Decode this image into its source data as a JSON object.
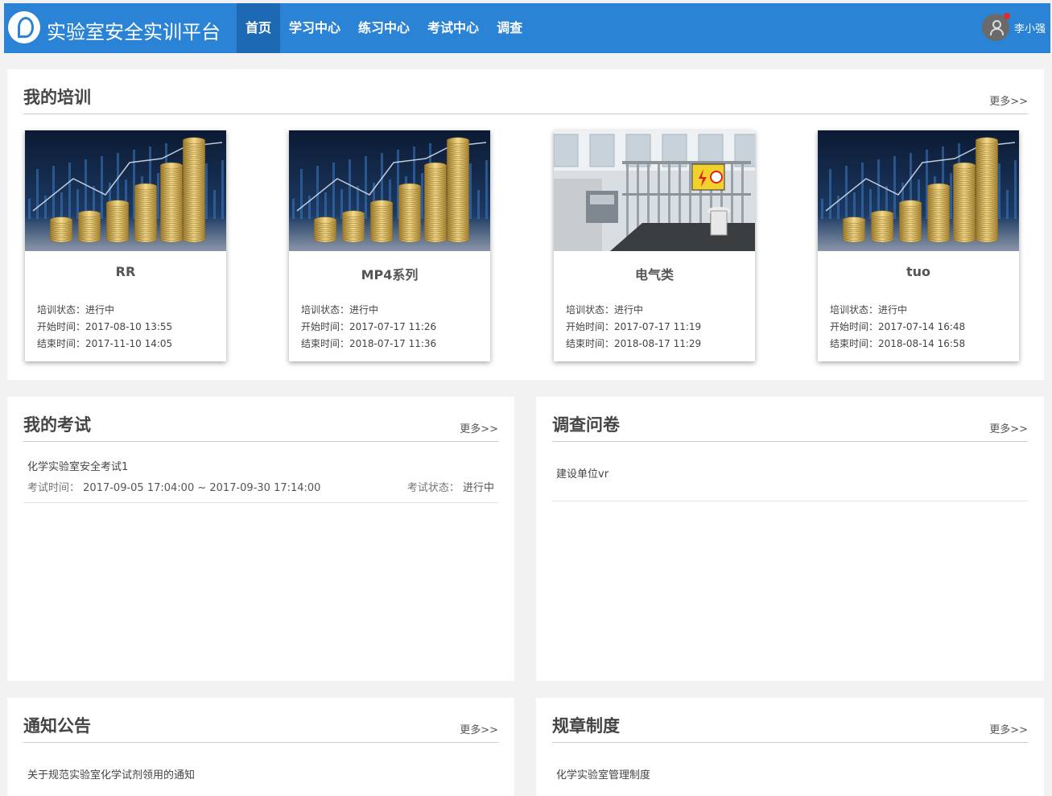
{
  "colors": {
    "primary": "#2a83d4",
    "nav_active": "#1e69b3",
    "notification_dot": "#e02a2a"
  },
  "header": {
    "brand": "实验室安全实训平台",
    "nav": [
      "首页",
      "学习中心",
      "练习中心",
      "考试中心",
      "调查"
    ],
    "active_nav": "首页",
    "user_name": "李小强"
  },
  "training": {
    "title": "我的培训",
    "more": "更多>>",
    "status_label": "培训状态：",
    "start_label": "开始时间：",
    "end_label": "结束时间：",
    "cards": [
      {
        "name": "RR",
        "image": "coins-chart",
        "status": "进行中",
        "start": "2017-08-10 13:55",
        "end": "2017-11-10 14:05"
      },
      {
        "name": "MP4系列",
        "image": "coins-chart",
        "status": "进行中",
        "start": "2017-07-17 11:26",
        "end": "2018-07-17 11:36"
      },
      {
        "name": "电气类",
        "image": "electrical-lab",
        "status": "进行中",
        "start": "2017-07-17 11:19",
        "end": "2018-08-17 11:29"
      },
      {
        "name": "tuo",
        "image": "coins-chart",
        "status": "进行中",
        "start": "2017-07-14 16:48",
        "end": "2018-08-14 16:58"
      }
    ]
  },
  "exams": {
    "title": "我的考试",
    "more": "更多>>",
    "items": [
      {
        "name": "化学实验室安全考试1",
        "time_label": "考试时间：",
        "time": "2017-09-05 17:04:00 ~ 2017-09-30 17:14:00",
        "status_label": "考试状态：",
        "status": "进行中"
      }
    ]
  },
  "surveys": {
    "title": "调查问卷",
    "more": "更多>>",
    "items": [
      "建设单位vr"
    ]
  },
  "notices": {
    "title": "通知公告",
    "more": "更多>>",
    "items": [
      "关于规范实验室化学试剂领用的通知"
    ]
  },
  "rules": {
    "title": "规章制度",
    "more": "更多>>",
    "items": [
      "化学实验室管理制度"
    ]
  }
}
